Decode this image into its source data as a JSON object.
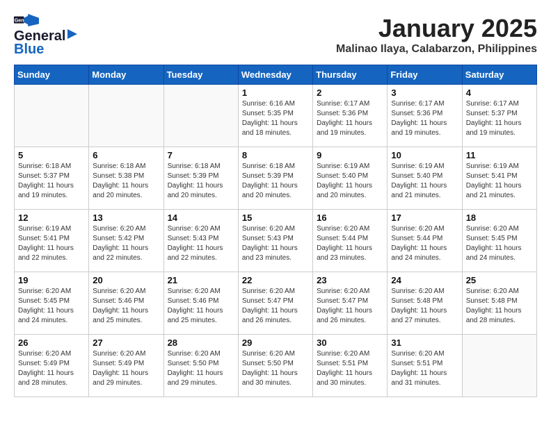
{
  "header": {
    "logo_line1": "General",
    "logo_line2": "Blue",
    "month": "January 2025",
    "location": "Malinao Ilaya, Calabarzon, Philippines"
  },
  "weekdays": [
    "Sunday",
    "Monday",
    "Tuesday",
    "Wednesday",
    "Thursday",
    "Friday",
    "Saturday"
  ],
  "weeks": [
    {
      "days": [
        {
          "num": "",
          "info": ""
        },
        {
          "num": "",
          "info": ""
        },
        {
          "num": "",
          "info": ""
        },
        {
          "num": "1",
          "info": "Sunrise: 6:16 AM\nSunset: 5:35 PM\nDaylight: 11 hours\nand 18 minutes."
        },
        {
          "num": "2",
          "info": "Sunrise: 6:17 AM\nSunset: 5:36 PM\nDaylight: 11 hours\nand 19 minutes."
        },
        {
          "num": "3",
          "info": "Sunrise: 6:17 AM\nSunset: 5:36 PM\nDaylight: 11 hours\nand 19 minutes."
        },
        {
          "num": "4",
          "info": "Sunrise: 6:17 AM\nSunset: 5:37 PM\nDaylight: 11 hours\nand 19 minutes."
        }
      ]
    },
    {
      "days": [
        {
          "num": "5",
          "info": "Sunrise: 6:18 AM\nSunset: 5:37 PM\nDaylight: 11 hours\nand 19 minutes."
        },
        {
          "num": "6",
          "info": "Sunrise: 6:18 AM\nSunset: 5:38 PM\nDaylight: 11 hours\nand 20 minutes."
        },
        {
          "num": "7",
          "info": "Sunrise: 6:18 AM\nSunset: 5:39 PM\nDaylight: 11 hours\nand 20 minutes."
        },
        {
          "num": "8",
          "info": "Sunrise: 6:18 AM\nSunset: 5:39 PM\nDaylight: 11 hours\nand 20 minutes."
        },
        {
          "num": "9",
          "info": "Sunrise: 6:19 AM\nSunset: 5:40 PM\nDaylight: 11 hours\nand 20 minutes."
        },
        {
          "num": "10",
          "info": "Sunrise: 6:19 AM\nSunset: 5:40 PM\nDaylight: 11 hours\nand 21 minutes."
        },
        {
          "num": "11",
          "info": "Sunrise: 6:19 AM\nSunset: 5:41 PM\nDaylight: 11 hours\nand 21 minutes."
        }
      ]
    },
    {
      "days": [
        {
          "num": "12",
          "info": "Sunrise: 6:19 AM\nSunset: 5:41 PM\nDaylight: 11 hours\nand 22 minutes."
        },
        {
          "num": "13",
          "info": "Sunrise: 6:20 AM\nSunset: 5:42 PM\nDaylight: 11 hours\nand 22 minutes."
        },
        {
          "num": "14",
          "info": "Sunrise: 6:20 AM\nSunset: 5:43 PM\nDaylight: 11 hours\nand 22 minutes."
        },
        {
          "num": "15",
          "info": "Sunrise: 6:20 AM\nSunset: 5:43 PM\nDaylight: 11 hours\nand 23 minutes."
        },
        {
          "num": "16",
          "info": "Sunrise: 6:20 AM\nSunset: 5:44 PM\nDaylight: 11 hours\nand 23 minutes."
        },
        {
          "num": "17",
          "info": "Sunrise: 6:20 AM\nSunset: 5:44 PM\nDaylight: 11 hours\nand 24 minutes."
        },
        {
          "num": "18",
          "info": "Sunrise: 6:20 AM\nSunset: 5:45 PM\nDaylight: 11 hours\nand 24 minutes."
        }
      ]
    },
    {
      "days": [
        {
          "num": "19",
          "info": "Sunrise: 6:20 AM\nSunset: 5:45 PM\nDaylight: 11 hours\nand 24 minutes."
        },
        {
          "num": "20",
          "info": "Sunrise: 6:20 AM\nSunset: 5:46 PM\nDaylight: 11 hours\nand 25 minutes."
        },
        {
          "num": "21",
          "info": "Sunrise: 6:20 AM\nSunset: 5:46 PM\nDaylight: 11 hours\nand 25 minutes."
        },
        {
          "num": "22",
          "info": "Sunrise: 6:20 AM\nSunset: 5:47 PM\nDaylight: 11 hours\nand 26 minutes."
        },
        {
          "num": "23",
          "info": "Sunrise: 6:20 AM\nSunset: 5:47 PM\nDaylight: 11 hours\nand 26 minutes."
        },
        {
          "num": "24",
          "info": "Sunrise: 6:20 AM\nSunset: 5:48 PM\nDaylight: 11 hours\nand 27 minutes."
        },
        {
          "num": "25",
          "info": "Sunrise: 6:20 AM\nSunset: 5:48 PM\nDaylight: 11 hours\nand 28 minutes."
        }
      ]
    },
    {
      "days": [
        {
          "num": "26",
          "info": "Sunrise: 6:20 AM\nSunset: 5:49 PM\nDaylight: 11 hours\nand 28 minutes."
        },
        {
          "num": "27",
          "info": "Sunrise: 6:20 AM\nSunset: 5:49 PM\nDaylight: 11 hours\nand 29 minutes."
        },
        {
          "num": "28",
          "info": "Sunrise: 6:20 AM\nSunset: 5:50 PM\nDaylight: 11 hours\nand 29 minutes."
        },
        {
          "num": "29",
          "info": "Sunrise: 6:20 AM\nSunset: 5:50 PM\nDaylight: 11 hours\nand 30 minutes."
        },
        {
          "num": "30",
          "info": "Sunrise: 6:20 AM\nSunset: 5:51 PM\nDaylight: 11 hours\nand 30 minutes."
        },
        {
          "num": "31",
          "info": "Sunrise: 6:20 AM\nSunset: 5:51 PM\nDaylight: 11 hours\nand 31 minutes."
        },
        {
          "num": "",
          "info": ""
        }
      ]
    }
  ]
}
